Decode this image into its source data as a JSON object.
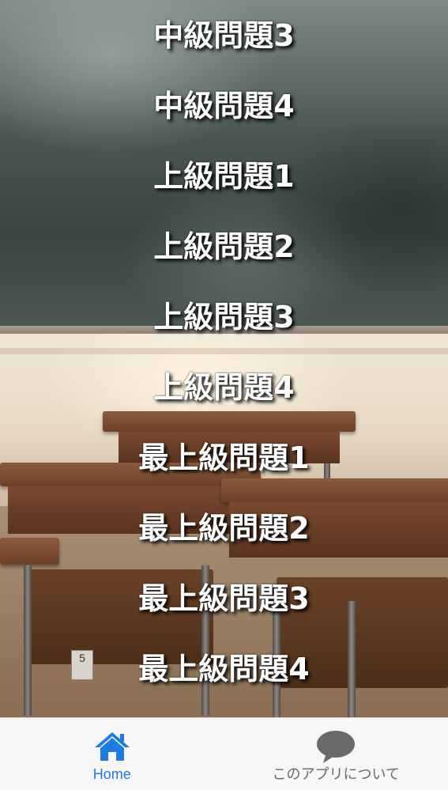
{
  "menu": {
    "items": [
      "中級問題3",
      "中級問題4",
      "上級問題1",
      "上級問題2",
      "上級問題3",
      "上級問題4",
      "最上級問題1",
      "最上級問題2",
      "最上級問題3",
      "最上級問題4"
    ]
  },
  "background": {
    "desk_tag_number": "5"
  },
  "tabbar": {
    "tabs": [
      {
        "label": "Home",
        "icon": "home-icon",
        "active": true
      },
      {
        "label": "このアプリについて",
        "icon": "speech-bubble-icon",
        "active": false
      }
    ]
  },
  "colors": {
    "active_tab": "#1e7be0",
    "inactive_tab": "#6a6a6a",
    "menu_text": "#ffffff",
    "tabbar_bg": "#f7f7f7"
  }
}
